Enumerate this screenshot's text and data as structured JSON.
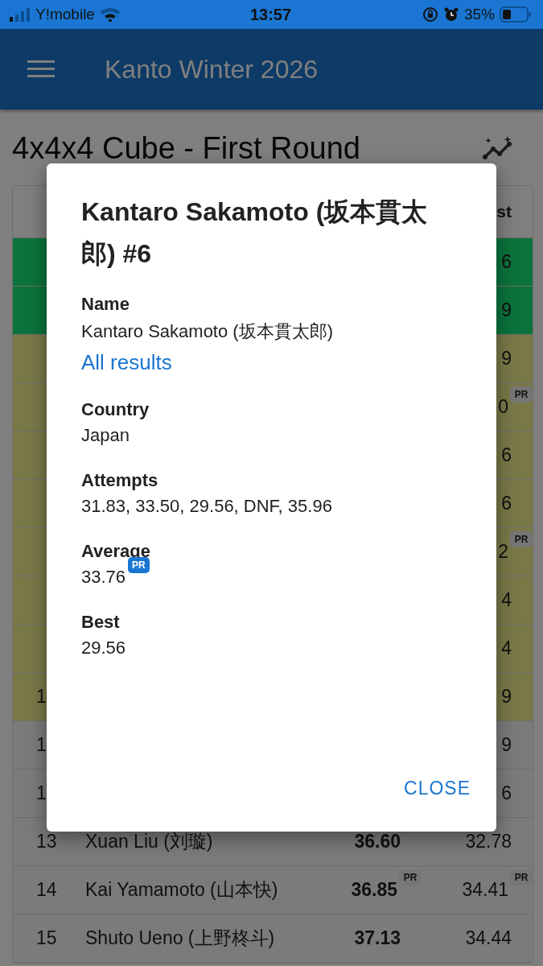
{
  "status_bar": {
    "carrier": "Y!mobile",
    "time": "13:57",
    "battery": "35%"
  },
  "app_bar": {
    "title": "Kanto Winter 2026"
  },
  "page": {
    "title": "4x4x4 Cube - First Round"
  },
  "table": {
    "header_fragment": "st",
    "rows": [
      {
        "kind": "advancing",
        "rank": "",
        "best": "6"
      },
      {
        "kind": "advancing",
        "rank": "",
        "best": "9"
      },
      {
        "kind": "qualified",
        "rank": "",
        "best": "9"
      },
      {
        "kind": "qualified",
        "rank": "",
        "best": "0",
        "best_badge": "PR"
      },
      {
        "kind": "qualified",
        "rank": "",
        "best": "6"
      },
      {
        "kind": "qualified",
        "rank": "",
        "best": "6"
      },
      {
        "kind": "qualified",
        "rank": "",
        "best": "2",
        "best_badge": "PR"
      },
      {
        "kind": "qualified",
        "rank": "",
        "best": "4"
      },
      {
        "kind": "qualified",
        "rank": "",
        "best": "4"
      },
      {
        "kind": "qualified",
        "rank": "1",
        "best": "9"
      },
      {
        "kind": "plain",
        "rank": "1",
        "best": "9"
      },
      {
        "kind": "plain",
        "rank": "1",
        "best": "6"
      },
      {
        "kind": "plain",
        "rank": "13",
        "name": "Xuan Liu (刘璇)",
        "average": "36.60",
        "best": "32.78"
      },
      {
        "kind": "plain",
        "rank": "14",
        "name": "Kai Yamamoto (山本快)",
        "average": "36.85",
        "average_badge": "PR",
        "best": "34.41",
        "best_badge": "PR"
      },
      {
        "kind": "plain",
        "rank": "15",
        "name": "Shuto Ueno (上野柊斗)",
        "average": "37.13",
        "best": "34.44"
      }
    ]
  },
  "dialog": {
    "title": "Kantaro Sakamoto (坂本貫太郎) #6",
    "fields": [
      {
        "label": "Name",
        "value": "Kantaro Sakamoto (坂本貫太郎)",
        "link": "All results"
      },
      {
        "label": "Country",
        "value": "Japan"
      },
      {
        "label": "Attempts",
        "value": "31.83, 33.50, 29.56, DNF, 35.96"
      },
      {
        "label": "Average",
        "value": "33.76",
        "badge": "PR"
      },
      {
        "label": "Best",
        "value": "29.56"
      }
    ],
    "close_button": "CLOSE"
  }
}
